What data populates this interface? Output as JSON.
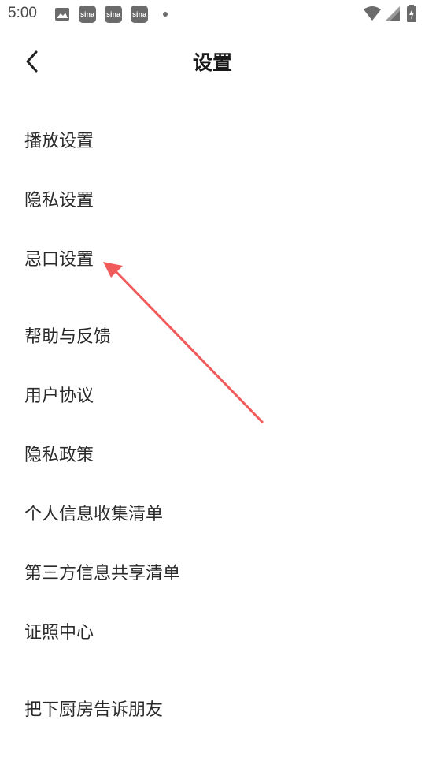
{
  "status_bar": {
    "time": "5:00",
    "app_icons": [
      "sina",
      "sina",
      "sina"
    ],
    "icons": [
      "image-icon",
      "wifi-icon",
      "signal-icon",
      "battery-icon"
    ]
  },
  "header": {
    "title": "设置",
    "back_icon": "chevron-left-icon"
  },
  "menu": {
    "items": [
      {
        "label": "播放设置"
      },
      {
        "label": "隐私设置"
      },
      {
        "label": "忌口设置"
      },
      {
        "label": "帮助与反馈"
      },
      {
        "label": "用户协议"
      },
      {
        "label": "隐私政策"
      },
      {
        "label": "个人信息收集清单"
      },
      {
        "label": "第三方信息共享清单"
      },
      {
        "label": "证照中心"
      },
      {
        "label": "把下厨房告诉朋友"
      }
    ]
  },
  "annotation": {
    "arrow_color": "#f05a5a"
  }
}
